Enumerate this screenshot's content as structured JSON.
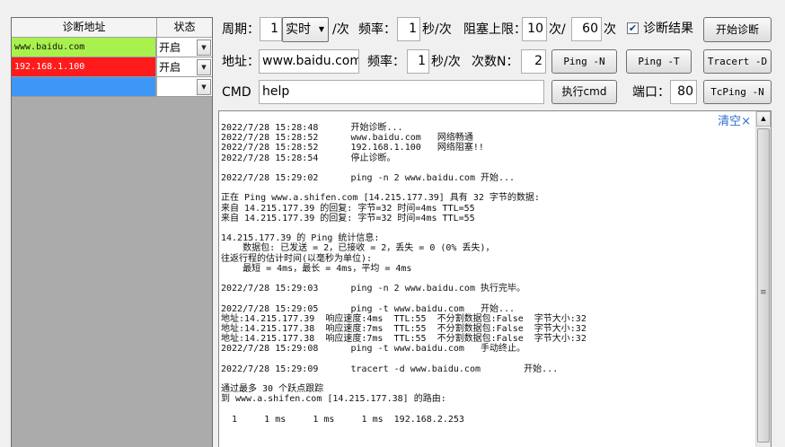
{
  "grid": {
    "headers": {
      "address": "诊断地址",
      "status": "状态"
    },
    "rows": [
      {
        "address": "www.baidu.com",
        "status": "开启",
        "color": "#a9f24e"
      },
      {
        "address": "192.168.1.100",
        "status": "开启",
        "color": "#ff1b1b"
      },
      {
        "address": "",
        "status": "",
        "color": "#3f97f5"
      }
    ]
  },
  "controls": {
    "period_label": "周期：",
    "period_value": "1",
    "period_mode": "实时",
    "per_time": "/次",
    "freq_label": "频率：",
    "freq_value": "1",
    "sec_per_time": "秒/次",
    "block_label": "阻塞上限：",
    "block_count": "10",
    "block_unit_a": "次/",
    "block_total": "60",
    "block_unit_b": "次",
    "diag_result_label": "诊断结果",
    "diag_result_checked": true,
    "start_button": "开始诊断",
    "address_label": "地址：",
    "address_value": "www.baidu.com",
    "freq2_label": "频率：",
    "freq2_value": "1",
    "sec_per_time2": "秒/次",
    "count_label": "次数N：",
    "count_value": "2",
    "ping_n_button": "Ping -N",
    "ping_t_button": "Ping -T",
    "tracert_button": "Tracert -D",
    "cmd_label": "CMD",
    "cmd_value": "help",
    "exec_button": "执行cmd",
    "port_label": "端口：",
    "port_value": "80",
    "tcping_button": "TcPing -N"
  },
  "log": {
    "clear_label": "清空×",
    "lines": [
      "2022/7/28 15:28:48      开始诊断...",
      "2022/7/28 15:28:52      www.baidu.com   网络畅通",
      "2022/7/28 15:28:52      192.168.1.100   网络阻塞!!",
      "2022/7/28 15:28:54      停止诊断。",
      "",
      "2022/7/28 15:29:02      ping -n 2 www.baidu.com 开始...",
      "",
      "正在 Ping www.a.shifen.com [14.215.177.39] 具有 32 字节的数据:",
      "来自 14.215.177.39 的回复: 字节=32 时间=4ms TTL=55",
      "来自 14.215.177.39 的回复: 字节=32 时间=4ms TTL=55",
      "",
      "14.215.177.39 的 Ping 统计信息:",
      "    数据包: 已发送 = 2，已接收 = 2，丢失 = 0 (0% 丢失)，",
      "往返行程的估计时间(以毫秒为单位):",
      "    最短 = 4ms，最长 = 4ms，平均 = 4ms",
      "",
      "2022/7/28 15:29:03      ping -n 2 www.baidu.com 执行完毕。",
      "",
      "2022/7/28 15:29:05      ping -t www.baidu.com   开始...",
      "地址:14.215.177.39  响应速度:4ms  TTL:55  不分割数据包:False  字节大小:32",
      "地址:14.215.177.38  响应速度:7ms  TTL:55  不分割数据包:False  字节大小:32",
      "地址:14.215.177.38  响应速度:7ms  TTL:55  不分割数据包:False  字节大小:32",
      "2022/7/28 15:29:08      ping -t www.baidu.com   手动终止。",
      "",
      "2022/7/28 15:29:09      tracert -d www.baidu.com        开始...",
      "",
      "通过最多 30 个跃点跟踪",
      "到 www.a.shifen.com [14.215.177.38] 的路由:",
      "",
      "  1     1 ms     1 ms     1 ms  192.168.2.253"
    ]
  }
}
